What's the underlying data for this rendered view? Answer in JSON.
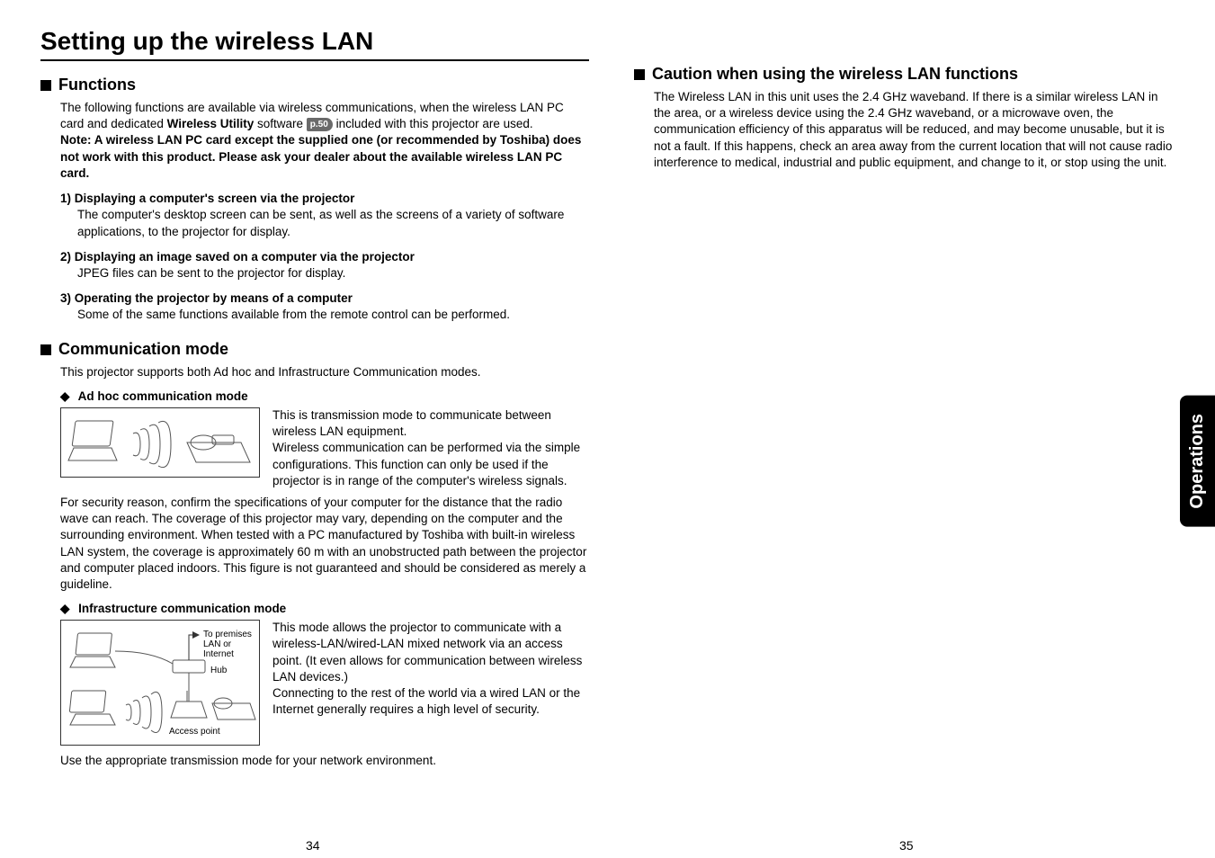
{
  "main_title": "Setting up the wireless LAN",
  "side_tab": "Operations",
  "page_left": "34",
  "page_right": "35",
  "left": {
    "section1_header": "Functions",
    "intro_before_bold": "The following functions are available via wireless communications, when the wireless LAN PC card and dedicated ",
    "intro_bold": "Wireless Utility",
    "intro_after_bold": " software ",
    "page_ref": "p.50",
    "intro_after_ref": " included with this projector are used.",
    "note": "Note: A wireless LAN PC card except the supplied one (or recommended by Toshiba) does not work with this product.  Please ask your dealer about the available wireless LAN PC card.",
    "items": [
      {
        "num": "1)",
        "title": "Displaying a computer's screen via the projector",
        "desc": "The computer's desktop screen can be sent, as well as the screens of a variety of software applications, to the projector for display."
      },
      {
        "num": "2)",
        "title": "Displaying an image saved on a computer via the projector",
        "desc": "JPEG files can be sent to the projector for display."
      },
      {
        "num": "3)",
        "title": "Operating the projector by means of a computer",
        "desc": "Some of the same functions available from the remote control can be performed."
      }
    ],
    "section2_header": "Communication mode",
    "section2_intro": "This projector supports both Ad hoc and Infrastructure Communication modes.",
    "adhoc_header": "Ad hoc communication mode",
    "adhoc_right": "This is transmission mode to communicate between wireless LAN equipment.\nWireless communication can be performed via the simple configurations. This function can only be used if the projector is in range of the computer's wireless signals.",
    "adhoc_below": "For security reason, confirm the specifications of your computer for the distance that the radio wave can reach. The coverage of this projector may vary, depending on the computer and the surrounding environment. When tested with a PC manufactured by Toshiba with built-in wireless LAN system, the coverage is approximately 60 m with an unobstructed path between the projector and computer placed indoors.  This figure is not guaranteed and should be considered as merely a guideline.",
    "infra_header": "Infrastructure communication mode",
    "infra_labels": {
      "premises": "To premises LAN or Internet",
      "hub": "Hub",
      "ap": "Access point"
    },
    "infra_right": "This mode allows the projector to communicate with a wireless-LAN/wired-LAN mixed network via an access point. (It even allows for communication between wireless LAN devices.)\nConnecting to the rest of the world via a wired LAN or the Internet generally requires a high level of security.",
    "infra_below": "Use the appropriate transmission mode for your network environment."
  },
  "right": {
    "section_header": "Caution when using the wireless LAN functions",
    "body": "The Wireless LAN in this unit uses the 2.4 GHz waveband.  If there is a similar wireless LAN in the area, or a wireless device using the 2.4 GHz waveband, or a microwave oven, the communication efficiency of this apparatus will be reduced, and may become unusable, but it is not a fault. If this happens, check an area away from the current location that will not cause radio interference to medical, industrial and public equipment, and change to it, or stop using the unit."
  }
}
